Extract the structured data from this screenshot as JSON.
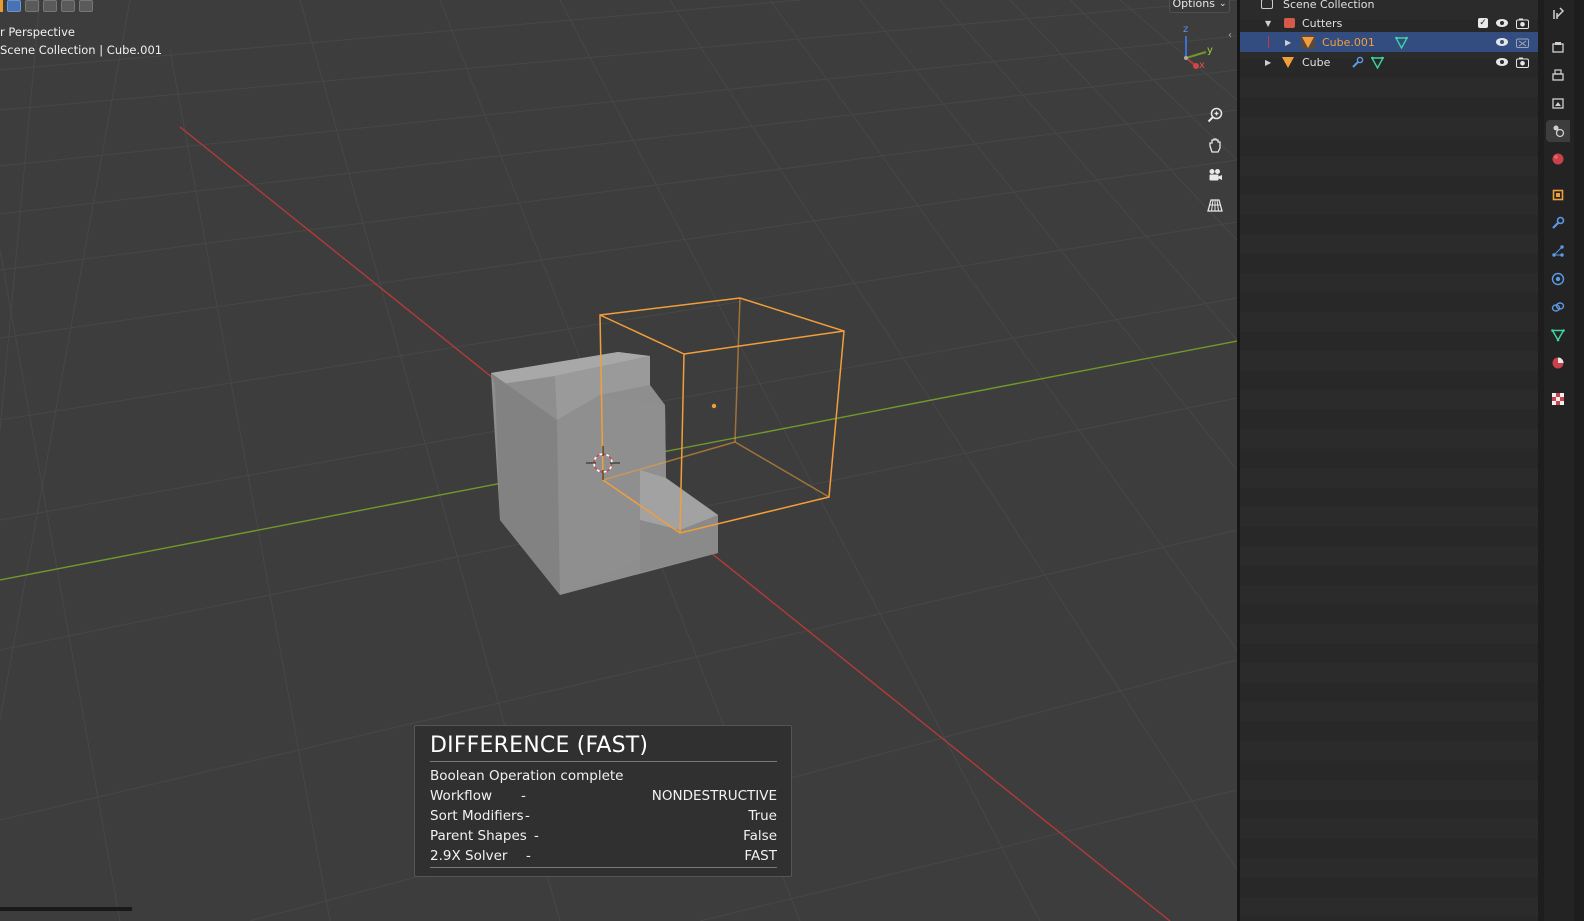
{
  "viewport": {
    "title": "r Perspective",
    "collection_path": "Scene Collection | Cube.001",
    "options_label": "Options",
    "nav_controls": [
      {
        "name": "zoom-icon",
        "glyph": "⊕"
      },
      {
        "name": "pan-hand-icon",
        "glyph": "✋"
      },
      {
        "name": "camera-view-icon",
        "glyph": "🎥"
      },
      {
        "name": "perspective-grid-icon",
        "glyph": "▦"
      }
    ],
    "axis_labels": {
      "z": "z",
      "y": "y",
      "x": "x"
    },
    "colors": {
      "x_axis": "#b33a3a",
      "y_axis": "#6f9a2a",
      "selection": "#f29e3a",
      "background": "#3d3d3d"
    }
  },
  "operator_panel": {
    "title": "DIFFERENCE (FAST)",
    "subtitle": "Boolean Operation complete",
    "rows": [
      {
        "label": "Workflow",
        "dash": "-",
        "value": "NONDESTRUCTIVE"
      },
      {
        "label": "Sort Modifiers",
        "dash": "-",
        "value": "True"
      },
      {
        "label": "Parent Shapes",
        "dash": "-",
        "value": "False"
      },
      {
        "label": "2.9X Solver",
        "dash": "-",
        "value": "FAST"
      }
    ]
  },
  "outliner": {
    "scene_collection": "Scene Collection",
    "items": [
      {
        "label": "Cutters",
        "type": "collection"
      },
      {
        "label": "Cube.001",
        "type": "mesh",
        "selected": true
      },
      {
        "label": "Cube",
        "type": "mesh",
        "selected": false
      }
    ]
  },
  "properties_tabs": [
    "tool",
    "render",
    "output",
    "view-layer",
    "scene",
    "world",
    "object",
    "modifiers",
    "particles",
    "physics",
    "constraints",
    "data",
    "material",
    "texture"
  ]
}
